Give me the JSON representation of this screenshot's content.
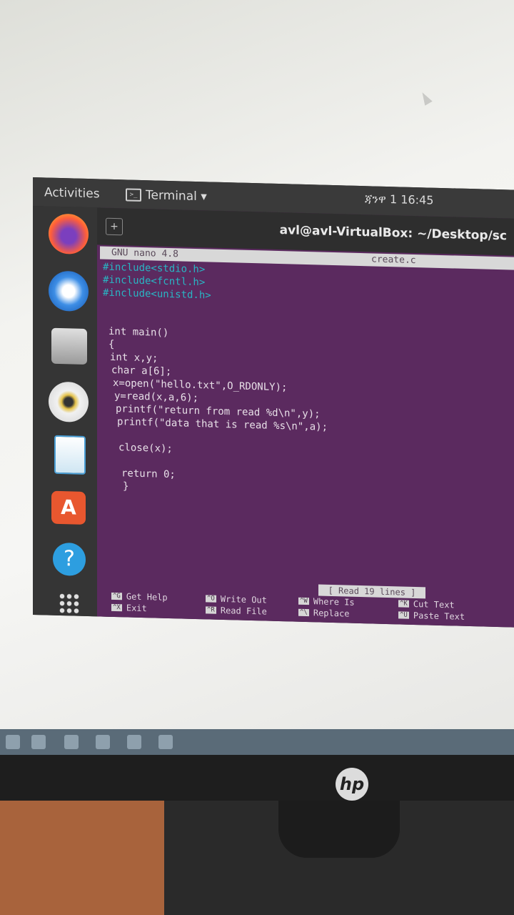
{
  "topbar": {
    "activities": "Activities",
    "app_name": "Terminal ▾",
    "clock": "ጃንዋ 1  16:45"
  },
  "terminal": {
    "title": "avl@avl-VirtualBox: ~/Desktop/sc",
    "nano_version": "GNU nano 4.8",
    "file_name": "create.c",
    "status": "[ Read 19 lines ]"
  },
  "code_lines": [
    "#include<stdio.h>",
    "#include<fcntl.h>",
    "#include<unistd.h>",
    "",
    "",
    "int main()",
    "{",
    "int x,y;",
    "char a[6];",
    "x=open(\"hello.txt\",O_RDONLY);",
    "y=read(x,a,6);",
    "printf(\"return from read %d\\n\",y);",
    "printf(\"data that is read %s\\n\",a);",
    "",
    "close(x);",
    "",
    "return 0;",
    "}"
  ],
  "shortcuts": [
    {
      "key": "^G",
      "label": "Get Help"
    },
    {
      "key": "^X",
      "label": "Exit"
    },
    {
      "key": "^O",
      "label": "Write Out"
    },
    {
      "key": "^R",
      "label": "Read File"
    },
    {
      "key": "^W",
      "label": "Where Is"
    },
    {
      "key": "^\\",
      "label": "Replace"
    },
    {
      "key": "^K",
      "label": "Cut Text"
    },
    {
      "key": "^U",
      "label": "Paste Text"
    }
  ],
  "dock": [
    "firefox-icon",
    "thunderbird-icon",
    "files-icon",
    "rhythmbox-icon",
    "writer-icon",
    "software-icon",
    "help-icon",
    "apps-grid-icon"
  ],
  "brand": {
    "hp": "hp"
  }
}
